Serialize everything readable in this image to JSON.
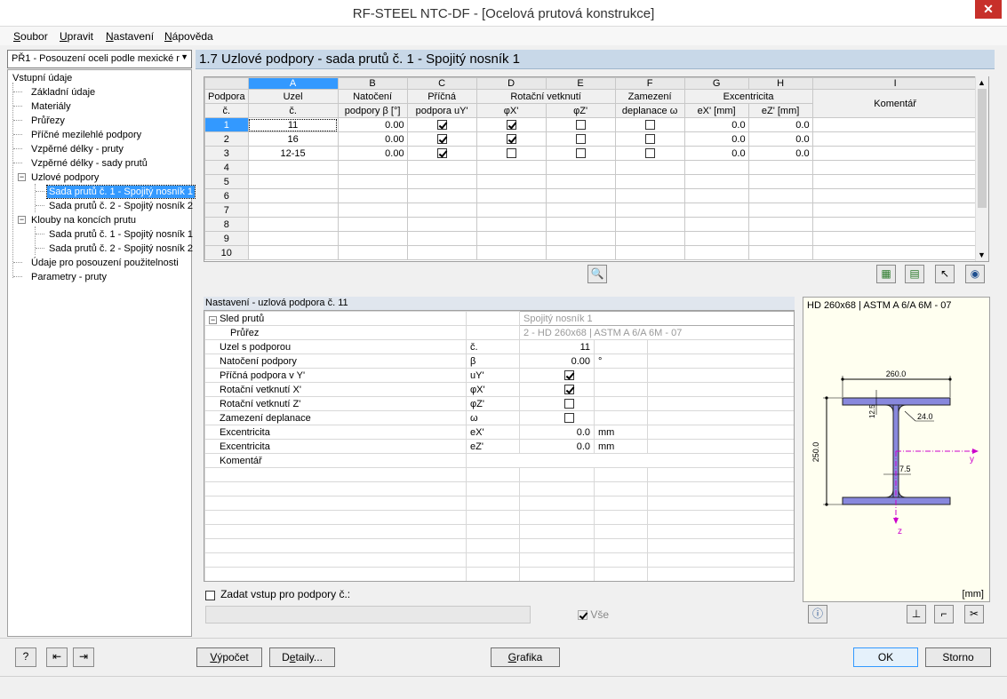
{
  "window": {
    "title": "RF-STEEL NTC-DF - [Ocelová prutová konstrukce]"
  },
  "menu": [
    {
      "label": "Soubor",
      "u": "S",
      "rest": "oubor"
    },
    {
      "label": "Upravit",
      "u": "U",
      "rest": "pravit"
    },
    {
      "label": "Nastavení",
      "u": "N",
      "rest": "astavení"
    },
    {
      "label": "Nápověda",
      "u": "N",
      "rest": "ápověda"
    }
  ],
  "case_select": {
    "value": "PŘ1 - Posouzení oceli podle mexické r"
  },
  "nav": {
    "items": [
      "Vstupní údaje",
      "Základní údaje",
      "Materiály",
      "Průřezy",
      "Příčné mezilehlé podpory",
      "Vzpěrné délky - pruty",
      "Vzpěrné délky - sady prutů",
      "Uzlové podpory",
      "Sada prutů č. 1 - Spojitý nosník 1",
      "Sada prutů č. 2 - Spojitý nosník 2",
      "Klouby na koncích prutu",
      "Sada prutů č. 1 - Spojitý nosník 1",
      "Sada prutů č. 2 - Spojitý nosník 2",
      "Údaje pro posouzení použitelnosti",
      "Parametry - pruty"
    ]
  },
  "header": {
    "title": "1.7 Uzlové podpory - sada prutů č. 1 - Spojitý nosník 1"
  },
  "grid": {
    "letters": [
      "A",
      "B",
      "C",
      "D",
      "E",
      "F",
      "G",
      "H",
      "I"
    ],
    "head1": [
      "Podpora",
      "Uzel",
      "Natočení",
      "Příčná",
      "Rotační vetknutí",
      "Zamezení",
      "Excentricita",
      "Komentář"
    ],
    "head2": [
      "č.",
      "č.",
      "podpory β [°]",
      "podpora uY'",
      "φX'",
      "φZ'",
      "deplanace ω",
      "eX' [mm]",
      "eZ' [mm]"
    ],
    "rows": [
      {
        "n": "1",
        "uzel": "11",
        "beta": "0.00",
        "u": true,
        "px": true,
        "pz": false,
        "w": false,
        "ex": "0.0",
        "ez": "0.0"
      },
      {
        "n": "2",
        "uzel": "16",
        "beta": "0.00",
        "u": true,
        "px": true,
        "pz": false,
        "w": false,
        "ex": "0.0",
        "ez": "0.0"
      },
      {
        "n": "3",
        "uzel": "12-15",
        "beta": "0.00",
        "u": true,
        "px": false,
        "pz": false,
        "w": false,
        "ex": "0.0",
        "ez": "0.0"
      },
      {
        "n": "4"
      },
      {
        "n": "5"
      },
      {
        "n": "6"
      },
      {
        "n": "7"
      },
      {
        "n": "8"
      },
      {
        "n": "9"
      },
      {
        "n": "10"
      }
    ]
  },
  "settings": {
    "title": "Nastavení - uzlová podpora č. 11",
    "sled": "Sled prutů",
    "sled_value": "Spojitý nosník 1",
    "prurez": "Průřez",
    "prurez_value": "2 - HD 260x68 | ASTM A 6/A 6M - 07",
    "rows": [
      {
        "label": "Uzel s podporou",
        "sym": "č.",
        "val": "11",
        "unit": ""
      },
      {
        "label": "Natočení podpory",
        "sym": "β",
        "val": "0.00",
        "unit": "°"
      },
      {
        "label": "Příčná podpora v Y'",
        "sym": "uY'",
        "check": true
      },
      {
        "label": "Rotační vetknutí X'",
        "sym": "φX'",
        "check": true
      },
      {
        "label": "Rotační vetknutí Z'",
        "sym": "φZ'",
        "check": false
      },
      {
        "label": "Zamezení deplanace",
        "sym": "ω",
        "check": false
      },
      {
        "label": "Excentricita",
        "sym": "eX'",
        "val": "0.0",
        "unit": "mm"
      },
      {
        "label": "Excentricita",
        "sym": "eZ'",
        "val": "0.0",
        "unit": "mm"
      },
      {
        "label": "Komentář",
        "sym": "",
        "val": "",
        "unit": ""
      }
    ],
    "zadat_label": "Zadat vstup pro podpory č.:",
    "vse_label": "Vše"
  },
  "preview": {
    "title": "HD 260x68 | ASTM A 6/A 6M - 07",
    "dim_b": "260.0",
    "dim_h": "250.0",
    "dim_tf": "12.5",
    "dim_r": "24.0",
    "dim_tw": "7.5",
    "axis_y": "y",
    "axis_z": "z",
    "unit": "[mm]"
  },
  "buttons": {
    "vypocet": {
      "u": "V",
      "rest": "ýpočet"
    },
    "detaily": {
      "pre": "D",
      "u": "e",
      "rest": "taily..."
    },
    "grafika": {
      "u": "G",
      "rest": "rafika"
    },
    "ok": "OK",
    "storno": "Storno"
  },
  "colors": {
    "accent": "#3399ff",
    "section_fill": "#8888dd",
    "axis": "#cc00cc"
  }
}
